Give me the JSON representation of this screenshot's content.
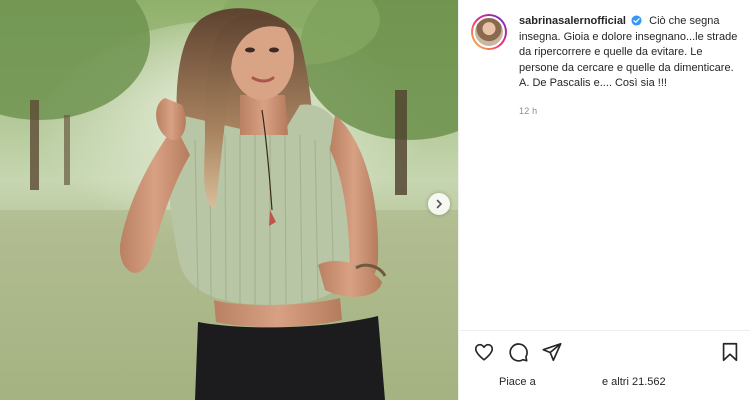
{
  "post": {
    "username": "sabrinasalernofficial",
    "caption": "Ciò che segna insegna. Gioia e dolore insegnano...le strade da ripercorrere e quelle da evitare. Le persone da cercare e quelle da dimenticare. A. De Pascalis e.... Così sia !!!",
    "time": "12 h",
    "likes_prefix": "Piace a",
    "likes_suffix": "e altri 21.562"
  },
  "icons": {
    "verified": "verified-badge-icon",
    "like": "heart-icon",
    "comment": "comment-icon",
    "share": "paper-plane-icon",
    "save": "bookmark-icon",
    "next": "chevron-right-icon"
  },
  "colors": {
    "verified_blue": "#3897f0",
    "text": "#262626",
    "muted": "#8e8e8e"
  }
}
